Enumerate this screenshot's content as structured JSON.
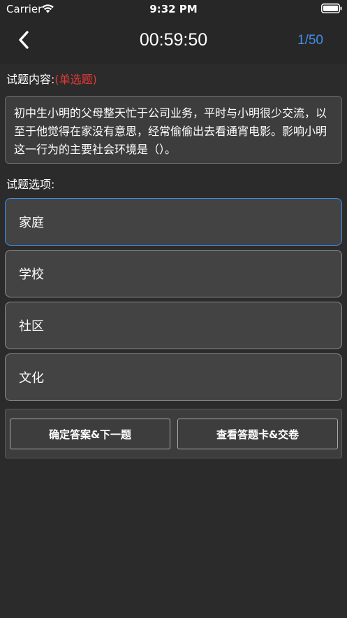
{
  "status_bar": {
    "carrier": "Carrier",
    "time": "9:32 PM"
  },
  "nav": {
    "timer": "00:59:50",
    "progress": "1/50",
    "back_icon": "chevron-left-icon"
  },
  "question": {
    "label": "试题内容:",
    "type": "(单选题)",
    "text": "初中生小明的父母整天忙于公司业务，平时与小明很少交流，以至于他觉得在家没有意思，经常偷偷出去看通宵电影。影响小明这一行为的主要社会环境是（）。"
  },
  "options_label": "试题选项:",
  "options": [
    {
      "label": "家庭",
      "selected": true
    },
    {
      "label": "学校",
      "selected": false
    },
    {
      "label": "社区",
      "selected": false
    },
    {
      "label": "文化",
      "selected": false
    }
  ],
  "actions": {
    "confirm_next": "确定答案&下一题",
    "view_card_submit": "查看答题卡&交卷"
  },
  "colors": {
    "background": "#2b2b2b",
    "accent": "#3f8ee9",
    "question_type": "#e53935"
  }
}
